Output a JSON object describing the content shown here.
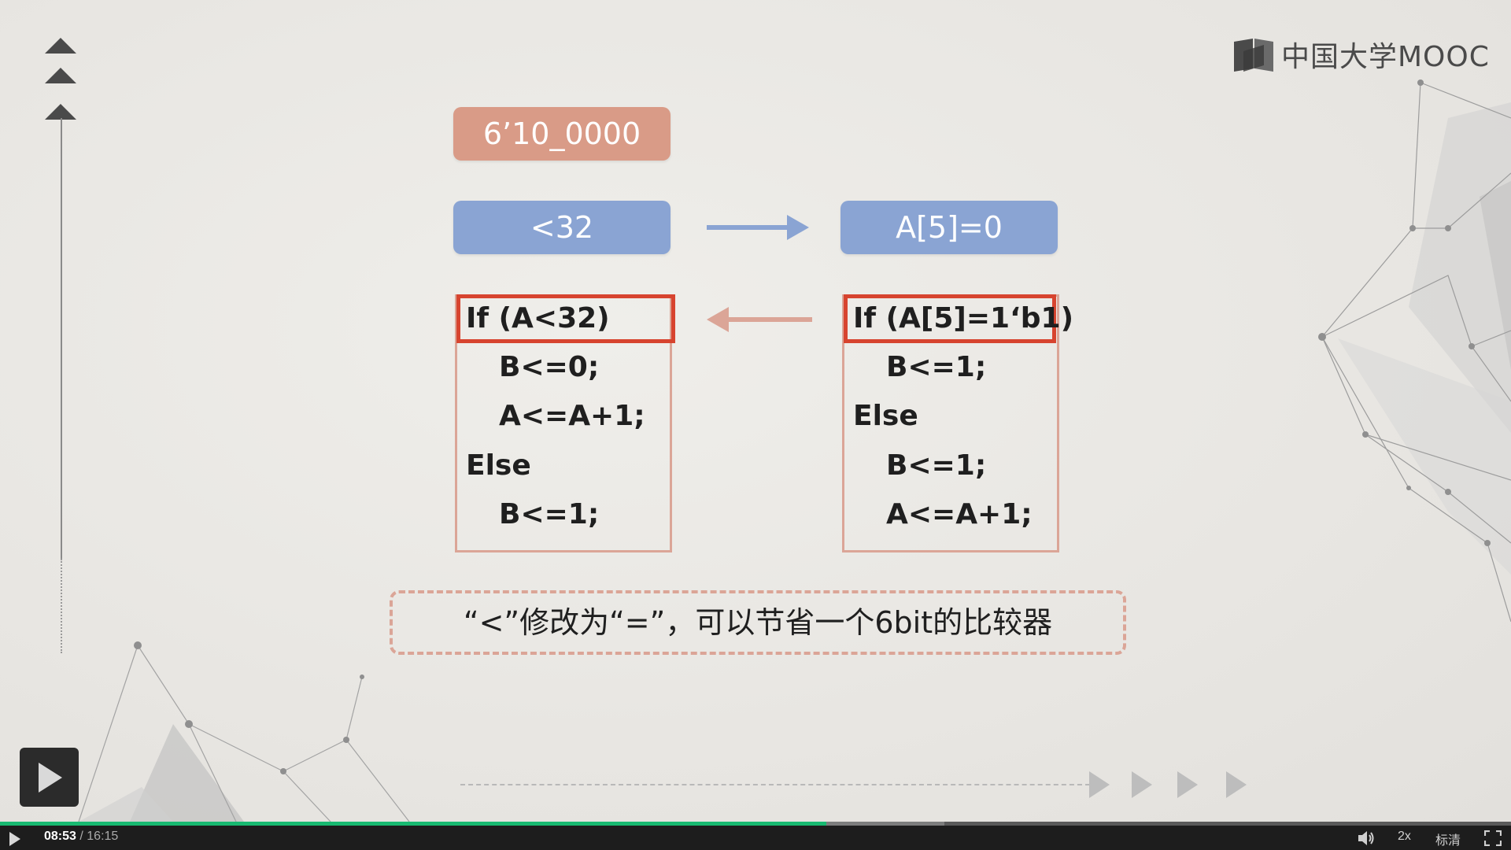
{
  "logo": {
    "text": "中国大学MOOC",
    "icon": "book-icon"
  },
  "slide": {
    "value_pill": "6’10_0000",
    "condition_pill": "<32",
    "result_pill": "A[5]=0",
    "left_code": [
      "If (A<32)",
      "B<=0;",
      "A<=A+1;",
      "Else",
      "B<=1;"
    ],
    "right_code": [
      "If (A[5]=1‘b1)",
      "B<=1;",
      "Else",
      "B<=1;",
      "A<=A+1;"
    ],
    "note": "“<”修改为“=”，可以节省一个6bit的比较器"
  },
  "player": {
    "current_time": "08:53",
    "separator": "/",
    "duration": "16:15",
    "progress": 0.547,
    "buffered": 0.625,
    "speed": "2x",
    "quality": "标清",
    "accent_color": "#18b971"
  }
}
